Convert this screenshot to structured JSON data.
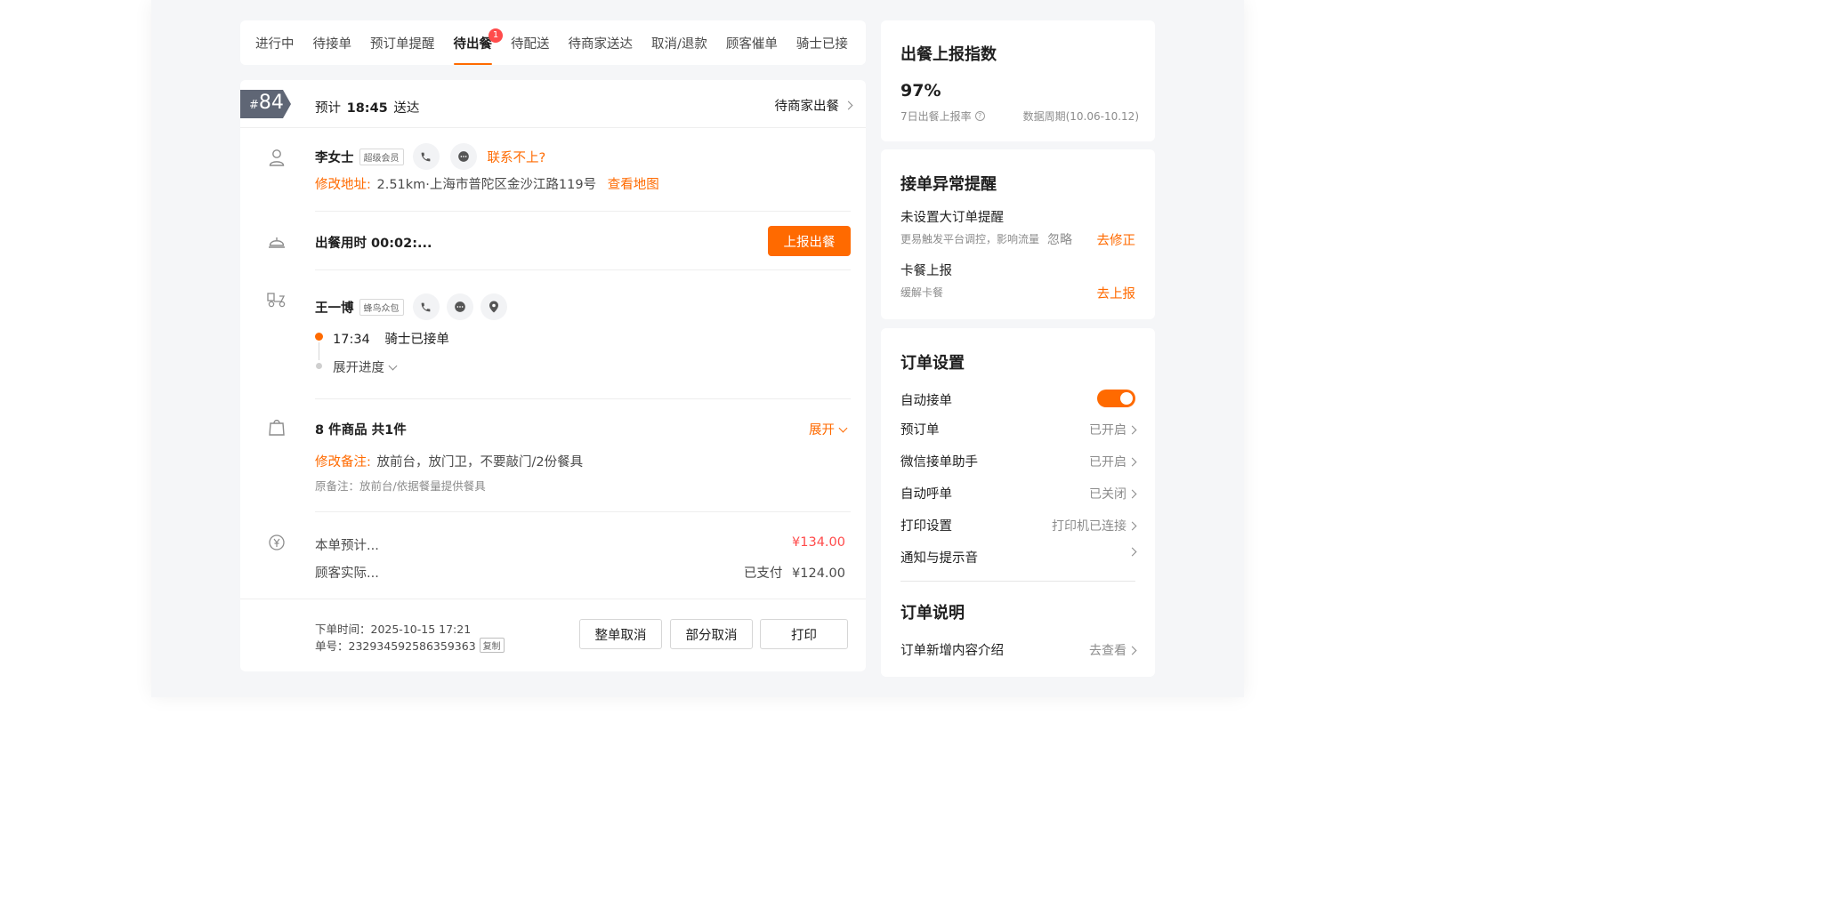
{
  "tabs": [
    {
      "label": "进行中"
    },
    {
      "label": "待接单"
    },
    {
      "label": "预订单提醒"
    },
    {
      "label": "待出餐",
      "badge": "1",
      "active": true
    },
    {
      "label": "待配送"
    },
    {
      "label": "待商家送达"
    },
    {
      "label": "取消/退款"
    },
    {
      "label": "顾客催单"
    },
    {
      "label": "骑士已接"
    }
  ],
  "order": {
    "hash": "#",
    "number": "84",
    "eta_prefix": "预计",
    "eta_time": "18:45",
    "eta_suffix": "送达",
    "status": "待商家出餐",
    "customer": {
      "name": "李女士",
      "tag": "超级会员",
      "contact_fail": "联系不上?",
      "addr_label": "修改地址:",
      "addr": "2.51km·上海市普陀区金沙江路119号",
      "map_link": "查看地图"
    },
    "prep": {
      "label": "出餐用时 00:02:...",
      "button": "上报出餐"
    },
    "rider": {
      "name": "王一博",
      "tag": "蜂鸟众包",
      "time": "17:34",
      "status": "骑士已接单",
      "expand": "展开进度"
    },
    "items": {
      "summary": "8 件商品 共1件",
      "expand": "展开",
      "note_label": "修改备注:",
      "note": "放前台，放门卫，不要敲门/2份餐具",
      "orig_note": "原备注：放前台/依据餐量提供餐具"
    },
    "price": {
      "est_label": "本单预计...",
      "est_value": "¥134.00",
      "paid_label": "顾客实际...",
      "paid_status": "已支付",
      "paid_value": "¥124.00"
    },
    "footer": {
      "order_time": "下单时间：2025-10-15 17:21",
      "order_id": "单号：232934592586359363",
      "copy": "复制",
      "cancel_all": "整单取消",
      "cancel_part": "部分取消",
      "print": "打印"
    }
  },
  "report": {
    "title": "出餐上报指数",
    "rate": "97%",
    "rate_label": "7日出餐上报率",
    "period": "数据周期(10.06-10.12)"
  },
  "alerts": {
    "title": "接单异常提醒",
    "item1_title": "未设置大订单提醒",
    "item1_desc": "更易触发平台调控，影响流量",
    "item1_ignore": "忽略",
    "item1_action": "去修正",
    "item2_title": "卡餐上报",
    "item2_desc": "缓解卡餐",
    "item2_action": "去上报"
  },
  "settings": {
    "title": "订单设置",
    "rows": [
      {
        "label": "自动接单",
        "value": "",
        "toggle": true
      },
      {
        "label": "预订单",
        "value": "已开启"
      },
      {
        "label": "微信接单助手",
        "value": "已开启"
      },
      {
        "label": "自动呼单",
        "value": "已关闭"
      },
      {
        "label": "打印设置",
        "value": "打印机已连接"
      },
      {
        "label": "通知与提示音",
        "value": ""
      }
    ],
    "notes_title": "订单说明",
    "notes_row_label": "订单新增内容介绍",
    "notes_row_value": "去查看"
  },
  "colors": {
    "accent": "#ff6a00",
    "price": "#ff4b4b",
    "badge": "#ff4b4b"
  }
}
